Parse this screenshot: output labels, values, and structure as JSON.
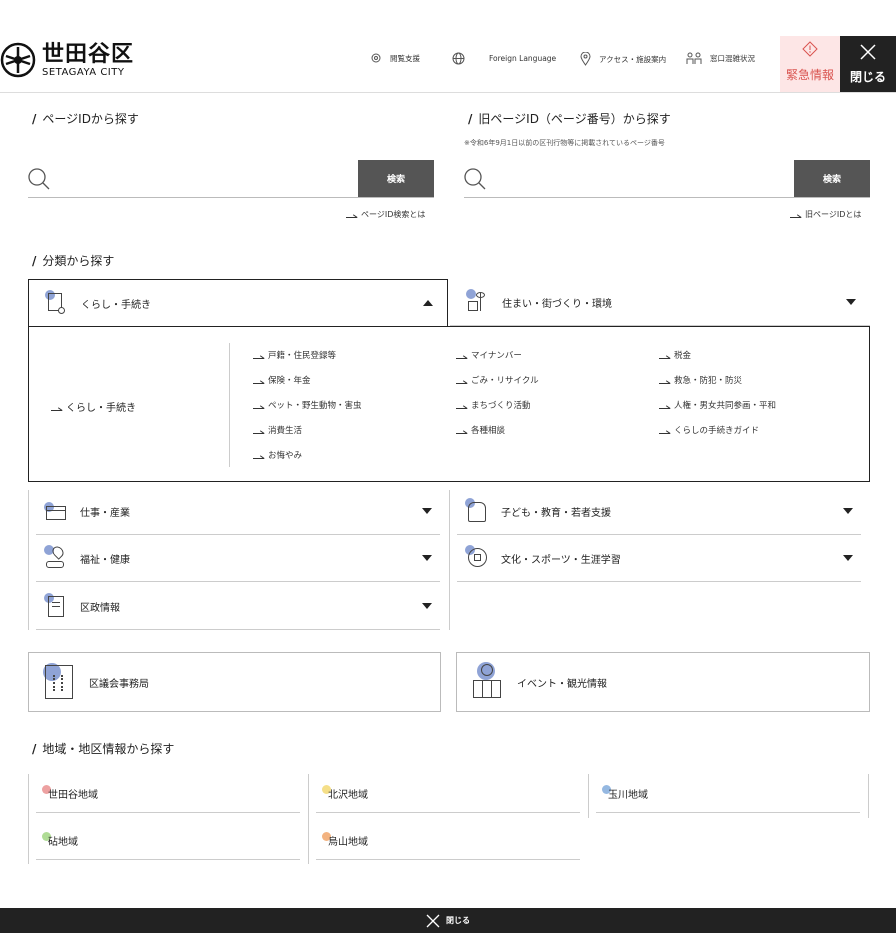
{
  "header": {
    "logo_jp": "世田谷区",
    "logo_en": "SETAGAYA CITY",
    "utils": [
      "閲覧支援",
      "Foreign Language",
      "アクセス・施設案内",
      "窓口混雑状況"
    ],
    "emergency": "緊急情報",
    "close": "閉じる",
    "emergency_color": "#d9534f"
  },
  "page_id": {
    "heading": "ページIDから探す",
    "search_button": "検索",
    "help": "ページID検索とは"
  },
  "old_page_id": {
    "heading": "旧ページID（ページ番号）から探す",
    "note": "※令和6年9月1日以前の区刊行物等に掲載されているページ番号",
    "search_button": "検索",
    "help": "旧ページIDとは"
  },
  "category": {
    "heading": "分類から探す",
    "items": [
      {
        "label": "くらし・手続き",
        "icon": "document-icon"
      },
      {
        "label": "住まい・街づくり・環境",
        "icon": "house-tree-icon"
      },
      {
        "label": "仕事・産業",
        "icon": "briefcase-icon"
      },
      {
        "label": "子ども・教育・若者支援",
        "icon": "backpack-icon"
      },
      {
        "label": "福祉・健康",
        "icon": "heart-hand-icon"
      },
      {
        "label": "文化・スポーツ・生涯学習",
        "icon": "ball-icon"
      },
      {
        "label": "区政情報",
        "icon": "building-doc-icon"
      }
    ],
    "panel": {
      "main": "くらし・手続き",
      "subs": [
        [
          "戸籍・住民登録等",
          "マイナンバー",
          "税金"
        ],
        [
          "保険・年金",
          "ごみ・リサイクル",
          "救急・防犯・防災"
        ],
        [
          "ペット・野生動物・害虫",
          "まちづくり活動",
          "人権・男女共同参画・平和"
        ],
        [
          "消費生活",
          "各種相談",
          "くらしの手続きガイド"
        ],
        [
          "お悔やみ"
        ]
      ]
    },
    "boxes": [
      {
        "label": "区議会事務局",
        "icon": "building-icon"
      },
      {
        "label": "イベント・観光情報",
        "icon": "map-person-icon"
      }
    ]
  },
  "region": {
    "heading": "地域・地区情報から探す",
    "items": [
      {
        "label": "世田谷地域",
        "color": "#e88a8a"
      },
      {
        "label": "北沢地域",
        "color": "#f2d76a"
      },
      {
        "label": "玉川地域",
        "color": "#7aa6d9"
      },
      {
        "label": "砧地域",
        "color": "#9bd37a"
      },
      {
        "label": "烏山地域",
        "color": "#f0a060"
      }
    ]
  },
  "footer": {
    "close": "閉じる"
  },
  "accent_color": "#8fa3d6"
}
